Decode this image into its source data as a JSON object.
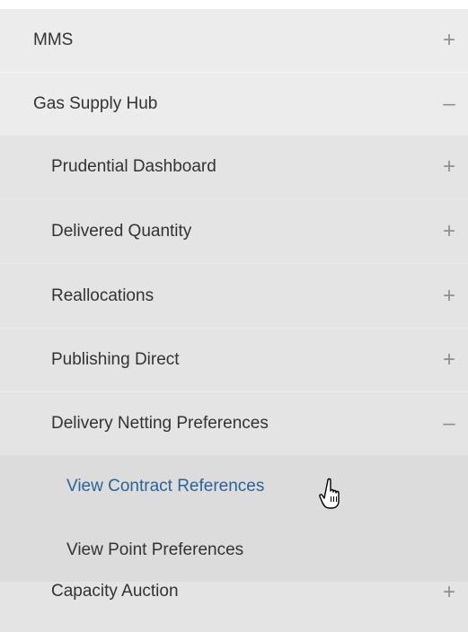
{
  "menu": {
    "items": [
      {
        "label": "MMS",
        "toggle": "+"
      },
      {
        "label": "Gas Supply Hub",
        "toggle": "–"
      },
      {
        "label": "Prudential Dashboard",
        "toggle": "+"
      },
      {
        "label": "Delivered Quantity",
        "toggle": "+"
      },
      {
        "label": "Reallocations",
        "toggle": "+"
      },
      {
        "label": "Publishing Direct",
        "toggle": "+"
      },
      {
        "label": "Delivery Netting Preferences",
        "toggle": "–"
      },
      {
        "label": "View Contract References"
      },
      {
        "label": "View Point Preferences"
      },
      {
        "label": "Capacity Auction",
        "toggle": "+"
      }
    ]
  },
  "colors": {
    "link": "#2a6496",
    "text": "#333333",
    "toggle": "#8f8f8f"
  },
  "cursor": {
    "icon": "hand-pointer-icon"
  }
}
